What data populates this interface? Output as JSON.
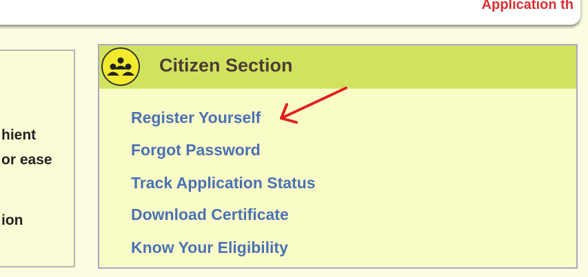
{
  "banner": {
    "text": "Application th"
  },
  "left_panel": {
    "lines": [
      "hient",
      "or ease",
      "ion"
    ]
  },
  "citizen_section": {
    "title": "Citizen Section",
    "icon": "citizens-group-icon",
    "links": [
      "Register Yourself",
      "Forgot Password",
      "Track Application Status",
      "Download Certificate",
      "Know Your Eligibility"
    ]
  },
  "colors": {
    "page_background": "#fbfce0",
    "header_green": "#d1e35e",
    "link_blue": "#4a72b4",
    "banner_red": "#d63031",
    "arrow_red": "#e02020"
  }
}
